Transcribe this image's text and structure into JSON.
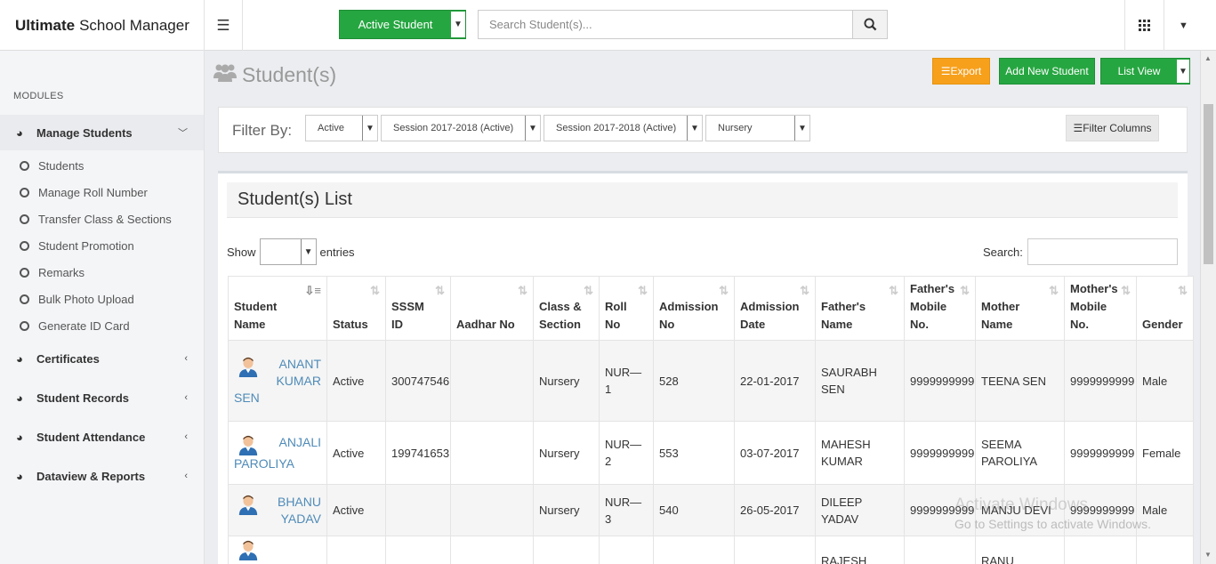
{
  "brand": {
    "bold": "Ultimate",
    "rest": "School Manager"
  },
  "topbar": {
    "active_student": "Active Student",
    "search_placeholder": "Search Student(s)..."
  },
  "sidebar": {
    "modules_label": "MODULES",
    "manage_students": "Manage Students",
    "submenu": [
      "Students",
      "Manage Roll Number",
      "Transfer Class & Sections",
      "Student Promotion",
      "Remarks",
      "Bulk Photo Upload",
      "Generate ID Card"
    ],
    "certificates": "Certificates",
    "student_records": "Student Records",
    "student_attendance": "Student Attendance",
    "dataview_reports": "Dataview & Reports"
  },
  "page": {
    "title": "Student(s)",
    "export": "Export",
    "add_new": "Add New Student",
    "list_view": "List View"
  },
  "filter": {
    "label": "Filter By:",
    "status": "Active",
    "session1": "Session 2017-2018 (Active)",
    "session2": "Session 2017-2018 (Active)",
    "class": "Nursery",
    "filter_columns": "Filter Columns"
  },
  "list": {
    "title": "Student(s) List",
    "show": "Show",
    "entries": "entries",
    "search": "Search:"
  },
  "columns": [
    [
      "Student",
      "Name"
    ],
    [
      "Status"
    ],
    [
      "SSSM",
      "ID"
    ],
    [
      "Aadhar No"
    ],
    [
      "Class &",
      "Section"
    ],
    [
      "Roll",
      "No"
    ],
    [
      "Admission",
      "No"
    ],
    [
      "Admission",
      "Date"
    ],
    [
      "Father's",
      "Name"
    ],
    [
      "Father's",
      "Mobile",
      "No."
    ],
    [
      "Mother",
      "Name"
    ],
    [
      "Mother's",
      "Mobile",
      "No."
    ],
    [
      "Gender"
    ]
  ],
  "rows": [
    {
      "name1": "ANANT",
      "name2": "KUMAR",
      "name3": "SEN",
      "status": "Active",
      "sssm": "300747546",
      "aadhar": "",
      "class": "Nursery",
      "roll": "NUR—1",
      "adm_no": "528",
      "adm_date": "22-01-2017",
      "father": "SAURABH SEN",
      "father_mobile": "9999999999",
      "mother": "TEENA SEN",
      "mother_mobile": "9999999999",
      "gender": "Male"
    },
    {
      "name1": "ANJALI",
      "name2": "PAROLIYA",
      "name3": "",
      "status": "Active",
      "sssm": "199741653",
      "aadhar": "",
      "class": "Nursery",
      "roll": "NUR—2",
      "adm_no": "553",
      "adm_date": "03-07-2017",
      "father": "MAHESH KUMAR",
      "father_mobile": "9999999999",
      "mother": "SEEMA PAROLIYA",
      "mother_mobile": "9999999999",
      "gender": "Female"
    },
    {
      "name1": "BHANU",
      "name2": "YADAV",
      "name3": "",
      "status": "Active",
      "sssm": "",
      "aadhar": "",
      "class": "Nursery",
      "roll": "NUR—3",
      "adm_no": "540",
      "adm_date": "26-05-2017",
      "father": "DILEEP YADAV",
      "father_mobile": "9999999999",
      "mother": "MANJU DEVI",
      "mother_mobile": "9999999999",
      "gender": "Male"
    },
    {
      "name1": "",
      "name2": "",
      "name3": "",
      "status": "",
      "sssm": "",
      "aadhar": "",
      "class": "",
      "roll": "",
      "adm_no": "",
      "adm_date": "",
      "father": "RAJESH",
      "father_mobile": "",
      "mother": "RANU",
      "mother_mobile": "",
      "gender": ""
    }
  ],
  "watermark": {
    "line1": "Activate Windows",
    "line2": "Go to Settings to activate Windows."
  }
}
